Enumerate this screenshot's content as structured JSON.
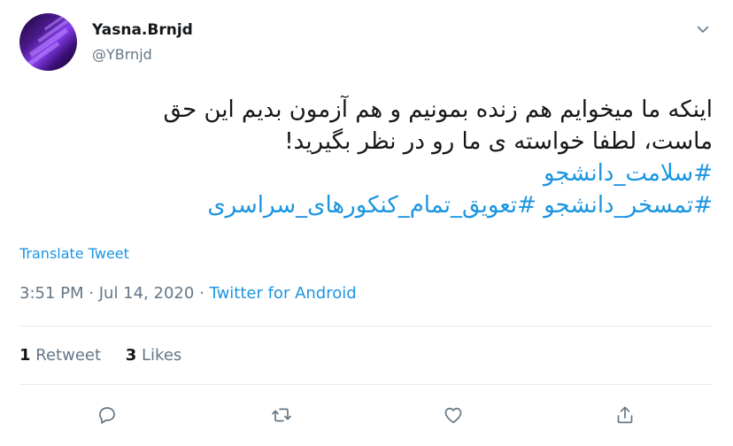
{
  "author": {
    "display_name": "Yasna.Brnjd",
    "handle": "@YBrnjd"
  },
  "tweet": {
    "line1": "اینکه ما میخوایم هم زنده بمونیم و هم آزمون بدیم این حق",
    "line2": "ماست، لطفا خواسته ی  ما رو در نظر بگیرید!",
    "hashtag1": "#سلامت_دانشجو",
    "hashtag2": "#تمسخر_دانشجو",
    "hashtag3": "#تعویق_تمام_کنکورهای_سراسری"
  },
  "translate_label": "Translate Tweet",
  "meta": {
    "time": "3:51 PM",
    "separator1": "·",
    "date": "Jul 14, 2020",
    "separator2": "·",
    "source": "Twitter for Android"
  },
  "stats": {
    "retweets_count": "1",
    "retweets_label": "Retweet",
    "likes_count": "3",
    "likes_label": "Likes"
  },
  "icons": {
    "caret": "chevron-down-icon",
    "reply": "reply-icon",
    "retweet": "retweet-icon",
    "like": "heart-icon",
    "share": "share-icon"
  },
  "colors": {
    "link": "#1b95e0",
    "secondary_text": "#657786",
    "primary_text": "#14171a",
    "divider": "#e6ecf0"
  }
}
